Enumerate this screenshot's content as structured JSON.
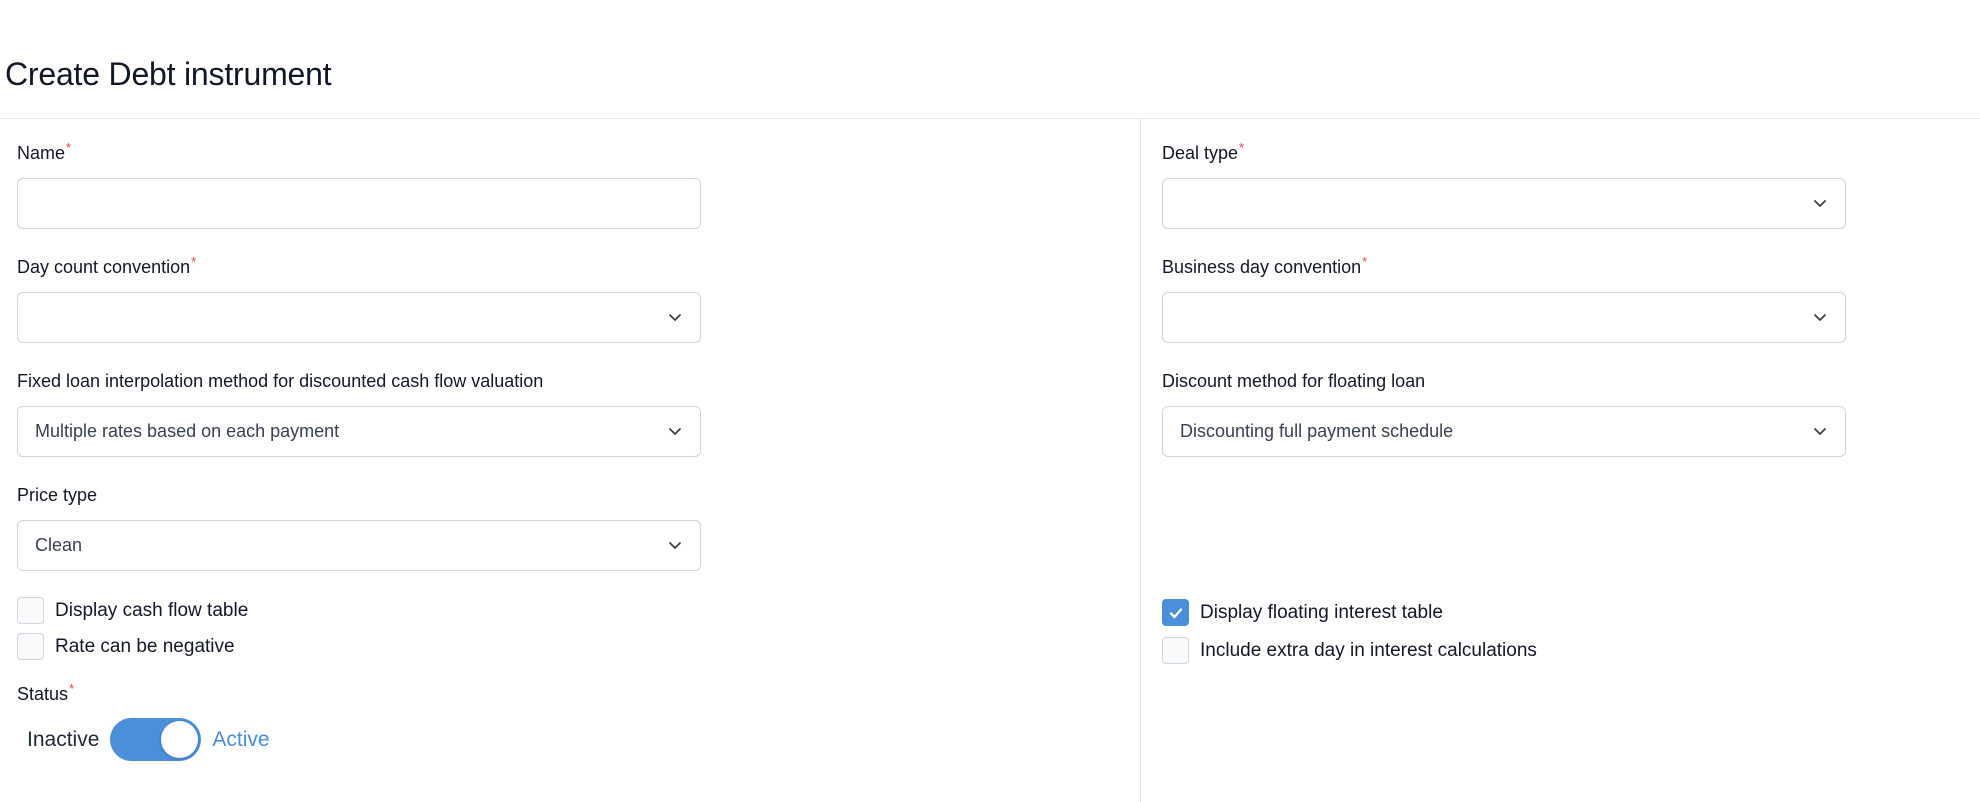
{
  "page": {
    "title": "Create Debt instrument"
  },
  "form": {
    "name": {
      "label": "Name",
      "required_mark": "*",
      "value": ""
    },
    "deal_type": {
      "label": "Deal type",
      "required_mark": "*",
      "value": ""
    },
    "day_count_convention": {
      "label": "Day count convention",
      "required_mark": "*",
      "value": ""
    },
    "business_day_convention": {
      "label": "Business day convention",
      "required_mark": "*",
      "value": ""
    },
    "fixed_loan_interpolation": {
      "label": "Fixed loan interpolation method for discounted cash flow valuation",
      "value": "Multiple rates based on each payment"
    },
    "discount_method_floating": {
      "label": "Discount method for floating loan",
      "value": "Discounting full payment schedule"
    },
    "price_type": {
      "label": "Price type",
      "value": "Clean"
    },
    "checkboxes": {
      "display_cash_flow_table": {
        "label": "Display cash flow table",
        "checked": false
      },
      "rate_can_be_negative": {
        "label": "Rate can be negative",
        "checked": false
      },
      "display_floating_interest_table": {
        "label": "Display floating interest table",
        "checked": true
      },
      "include_extra_day": {
        "label": "Include extra day in interest calculations",
        "checked": false
      }
    },
    "status": {
      "label": "Status",
      "required_mark": "*",
      "off_label": "Inactive",
      "on_label": "Active",
      "active": true
    }
  },
  "colors": {
    "accent": "#4a8fd9",
    "required": "#ef4444",
    "border": "#d1d5db",
    "divider": "#e5e7eb"
  },
  "icons": {
    "select_chevron": "chevron-down-icon",
    "checkbox_check": "check-icon"
  }
}
